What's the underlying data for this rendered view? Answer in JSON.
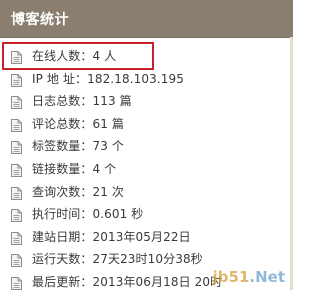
{
  "widget": {
    "title": "博客统计",
    "rows": [
      {
        "text": "在线人数：4 人",
        "icon": "document-icon"
      },
      {
        "text": "IP 地 址：182.18.103.195",
        "icon": "document-icon"
      },
      {
        "text": "日志总数：113 篇",
        "icon": "document-icon"
      },
      {
        "text": "评论总数：61 篇",
        "icon": "document-icon"
      },
      {
        "text": "标签数量：73 个",
        "icon": "document-icon"
      },
      {
        "text": "链接数量：4 个",
        "icon": "document-icon"
      },
      {
        "text": "查询次数：21 次",
        "icon": "document-icon"
      },
      {
        "text": "执行时间：0.601 秒",
        "icon": "document-icon"
      },
      {
        "text": "建站日期：2013年05月22日",
        "icon": "document-icon"
      },
      {
        "text": "运行天数：27天23时10分38秒",
        "icon": "document-icon"
      },
      {
        "text": "最后更新：2013年06月18日 20时",
        "icon": "document-icon"
      }
    ]
  },
  "watermark": {
    "part1": "jb51",
    "part2": ".Net"
  },
  "colors": {
    "header_bg": "#8a7f6f",
    "highlight": "#c8232a",
    "text": "#3a3a3a"
  }
}
